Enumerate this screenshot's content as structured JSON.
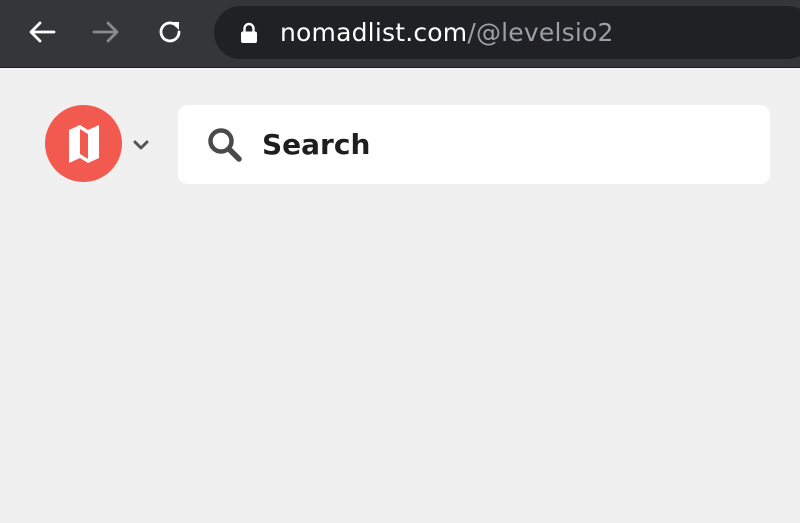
{
  "browser": {
    "url_host": "nomadlist.com",
    "url_path": "/@levelsio2",
    "toolbar_bg": "#35363a",
    "omnibox_bg": "#202124",
    "icons": {
      "back": "arrow-left-icon",
      "forward": "arrow-right-icon",
      "reload": "reload-icon",
      "lock": "lock-icon"
    }
  },
  "page": {
    "background": "#f0f0f0",
    "logo": {
      "icon": "nomadlist-logo-icon",
      "color": "#f25a50",
      "menu_icon": "chevron-down-icon"
    },
    "search": {
      "label": "Search",
      "icon": "search-icon"
    }
  }
}
